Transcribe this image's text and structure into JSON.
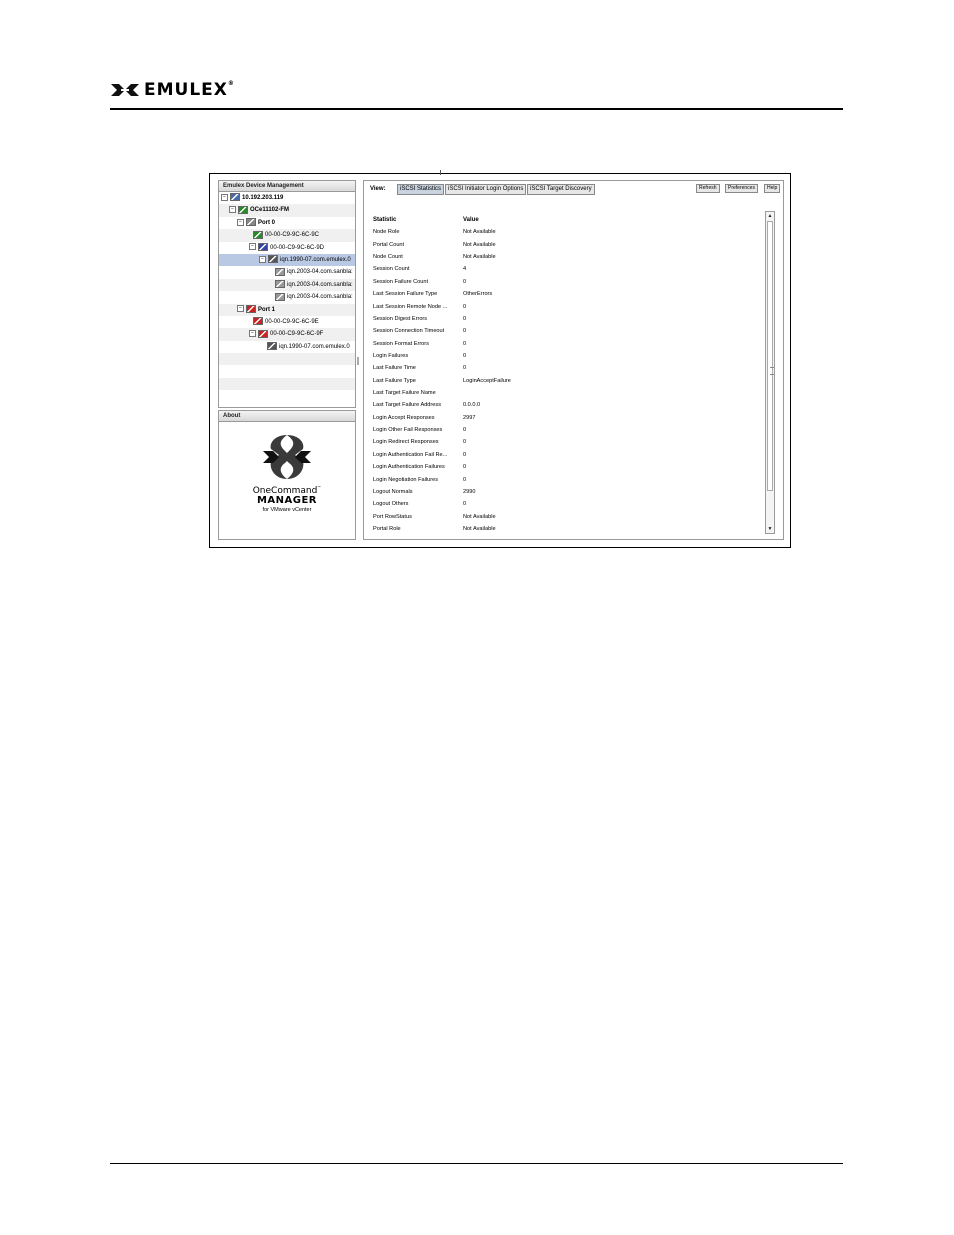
{
  "brand": {
    "name": "EMULEX",
    "tm": "®"
  },
  "tree": {
    "title": "Emulex Device Management",
    "rows": [
      {
        "label": "10.192.203.119",
        "expander": "−",
        "bold": true
      },
      {
        "label": "OCe11102-FM",
        "expander": "−",
        "bold": true
      },
      {
        "label": "Port 0",
        "expander": "−",
        "bold": true
      },
      {
        "label": "00-00-C9-9C-6C-9C",
        "expander": "",
        "bold": false
      },
      {
        "label": "00-00-C9-9C-6C-9D",
        "expander": "−",
        "bold": false
      },
      {
        "label": "iqn.1990-07.com.emulex.0",
        "expander": "−",
        "bold": false
      },
      {
        "label": "iqn.2003-04.com.sanbla:",
        "expander": "",
        "bold": false
      },
      {
        "label": "iqn.2003-04.com.sanbla:",
        "expander": "",
        "bold": false
      },
      {
        "label": "iqn.2003-04.com.sanbla:",
        "expander": "",
        "bold": false
      },
      {
        "label": "Port 1",
        "expander": "−",
        "bold": true
      },
      {
        "label": "00-00-C9-9C-6C-9E",
        "expander": "",
        "bold": false
      },
      {
        "label": "00-00-C9-9C-6C-9F",
        "expander": "−",
        "bold": false
      },
      {
        "label": "iqn.1990-07.com.emulex.0",
        "expander": "",
        "bold": false
      }
    ]
  },
  "about": {
    "title": "About",
    "product_line1": "OneCommand",
    "product_tm": "™",
    "product_line2": "MANAGER",
    "product_line3": "for VMware vCenter"
  },
  "view": {
    "label": "View:",
    "tabs": [
      "iSCSI Statistics",
      "iSCSI Initiator Login Options",
      "iSCSI Target Discovery"
    ],
    "actions": [
      "Refresh",
      "Preferences",
      "Help"
    ]
  },
  "stats": {
    "headers": {
      "name": "Statistic",
      "value": "Value"
    },
    "rows": [
      {
        "name": "Node Role",
        "value": "Not Available"
      },
      {
        "name": "Portal Count",
        "value": "Not Available"
      },
      {
        "name": "Node Count",
        "value": "Not Available"
      },
      {
        "name": "Session Count",
        "value": "4"
      },
      {
        "name": "Session Failure Count",
        "value": "0"
      },
      {
        "name": "Last Session Failure Type",
        "value": "OtherErrors"
      },
      {
        "name": "Last Session Remote Node ...",
        "value": "0"
      },
      {
        "name": "Session Digest Errors",
        "value": "0"
      },
      {
        "name": "Session Connection Timeout",
        "value": "0"
      },
      {
        "name": "Session Format Errors",
        "value": "0"
      },
      {
        "name": "Login Failures",
        "value": "0"
      },
      {
        "name": "Last Failure Time",
        "value": "0"
      },
      {
        "name": "Last Failure Type",
        "value": "LoginAcceptFailure"
      },
      {
        "name": "Last Target Failure Name",
        "value": ""
      },
      {
        "name": "Last Target Failure Address",
        "value": "0.0.0.0"
      },
      {
        "name": "Login Accept Responses",
        "value": "2997"
      },
      {
        "name": "Login Other Fail Responses",
        "value": "0"
      },
      {
        "name": "Login Redirect Responses",
        "value": "0"
      },
      {
        "name": "Login Authentication Fail Re...",
        "value": "0"
      },
      {
        "name": "Login Authentication Failures",
        "value": "0"
      },
      {
        "name": "Login Negotiation Failures",
        "value": "0"
      },
      {
        "name": "Logout Normals",
        "value": "2990"
      },
      {
        "name": "Logout Others",
        "value": "0"
      },
      {
        "name": "Port RowStatus",
        "value": "Not Available"
      },
      {
        "name": "Portal Role",
        "value": "Not Available"
      }
    ]
  },
  "colors": {
    "selection": "#b9c9e4",
    "active_tab": "#c9d2df",
    "nic_green": "#2a8a2a",
    "port_red": "#cc2222",
    "port_blue": "#3344aa"
  }
}
